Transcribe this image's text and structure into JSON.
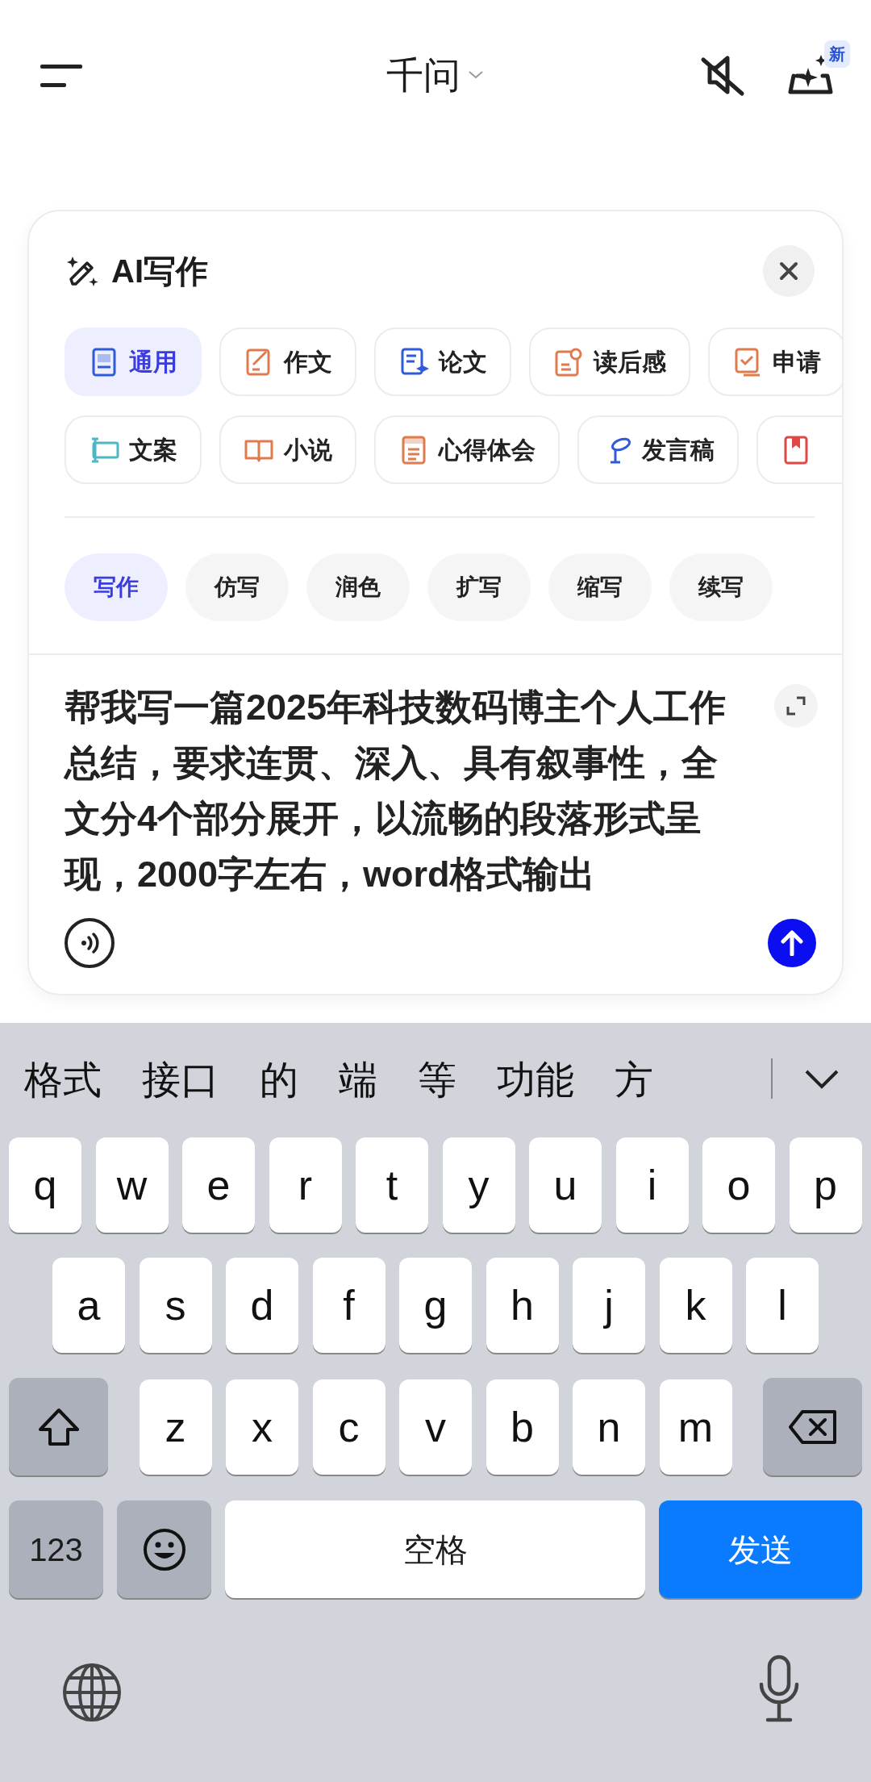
{
  "header": {
    "title": "千问",
    "badge": "新",
    "muted": true
  },
  "panel": {
    "title": "AI写作",
    "categories": [
      {
        "label": "通用",
        "selected": true,
        "color": "#2f5bd8"
      },
      {
        "label": "作文",
        "selected": false,
        "color": "#e07a4f"
      },
      {
        "label": "论文",
        "selected": false,
        "color": "#2f5bd8"
      },
      {
        "label": "读后感",
        "selected": false,
        "color": "#e07a4f"
      },
      {
        "label": "申请",
        "selected": false,
        "color": "#e07a4f"
      },
      {
        "label": "文案",
        "selected": false,
        "color": "#4bb8c4"
      },
      {
        "label": "小说",
        "selected": false,
        "color": "#e07a4f"
      },
      {
        "label": "心得体会",
        "selected": false,
        "color": "#e07a4f"
      },
      {
        "label": "发言稿",
        "selected": false,
        "color": "#2f5bd8"
      },
      {
        "selected": false,
        "color": "#e04848"
      }
    ],
    "modes": [
      {
        "label": "写作",
        "selected": true
      },
      {
        "label": "仿写",
        "selected": false
      },
      {
        "label": "润色",
        "selected": false
      },
      {
        "label": "扩写",
        "selected": false
      },
      {
        "label": "缩写",
        "selected": false
      },
      {
        "label": "续写",
        "selected": false
      }
    ],
    "prompt": "帮我写一篇2025年科技数码博主个人工作总结，要求连贯、深入、具有叙事性，全文分4个部分展开，以流畅的段落形式呈现，2000字左右，word格式输出"
  },
  "keyboard": {
    "candidates": [
      "格式",
      "接口",
      "的",
      "端",
      "等",
      "功能",
      "方"
    ],
    "rows": [
      [
        "q",
        "w",
        "e",
        "r",
        "t",
        "y",
        "u",
        "i",
        "o",
        "p"
      ],
      [
        "a",
        "s",
        "d",
        "f",
        "g",
        "h",
        "j",
        "k",
        "l"
      ],
      [
        "z",
        "x",
        "c",
        "v",
        "b",
        "n",
        "m"
      ]
    ],
    "numbers_key": "123",
    "space_key": "空格",
    "send_key": "发送"
  }
}
